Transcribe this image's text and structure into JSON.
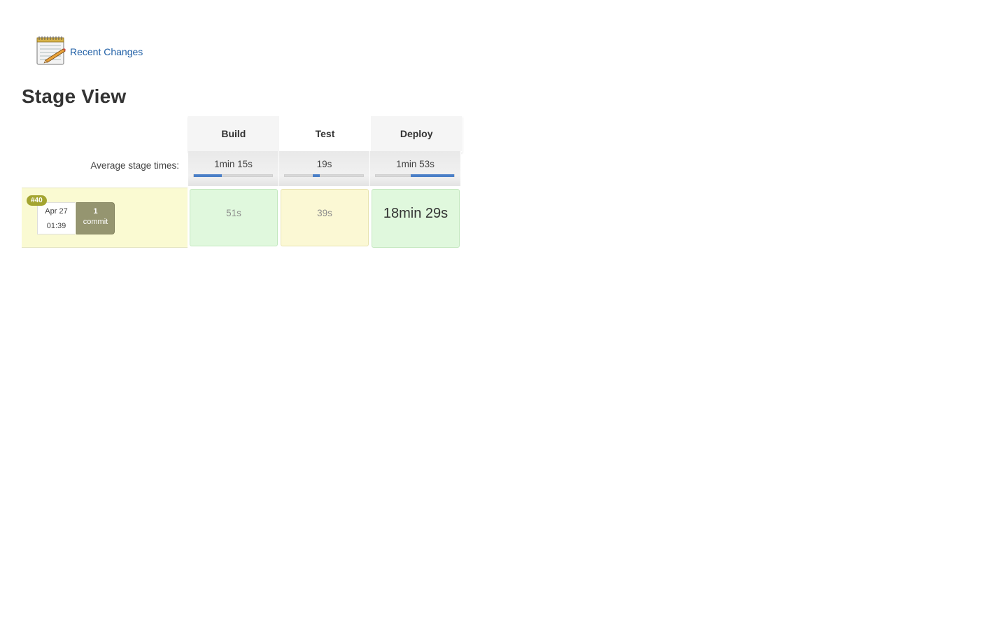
{
  "recent_changes": {
    "label": "Recent Changes",
    "icon": "notepad-icon"
  },
  "page_title": "Stage View",
  "stage_view": {
    "average_label": "Average stage times:",
    "stages": [
      {
        "name": "Build",
        "avg_time": "1min 15s",
        "avg_fraction": 0.36
      },
      {
        "name": "Test",
        "avg_time": "19s",
        "avg_fraction": 0.09
      },
      {
        "name": "Deploy",
        "avg_time": "1min 53s",
        "avg_fraction": 0.55
      }
    ],
    "builds": [
      {
        "number": "#40",
        "date": "Apr 27",
        "time": "01:39",
        "commit_count": "1",
        "commit_label": "commit",
        "stage_times": [
          "51s",
          "39s",
          "18min 29s"
        ],
        "stage_status": [
          "success",
          "unstable",
          "success"
        ]
      }
    ]
  },
  "colors": {
    "link": "#1f5fa6",
    "build_row_bg": "#fafad2",
    "badge": "#a4a531",
    "commit_btn": "#959570",
    "success_cell": "#e0f8dd",
    "unstable_cell": "#fbf8d4",
    "progress_fill": "#4a7fc7"
  }
}
